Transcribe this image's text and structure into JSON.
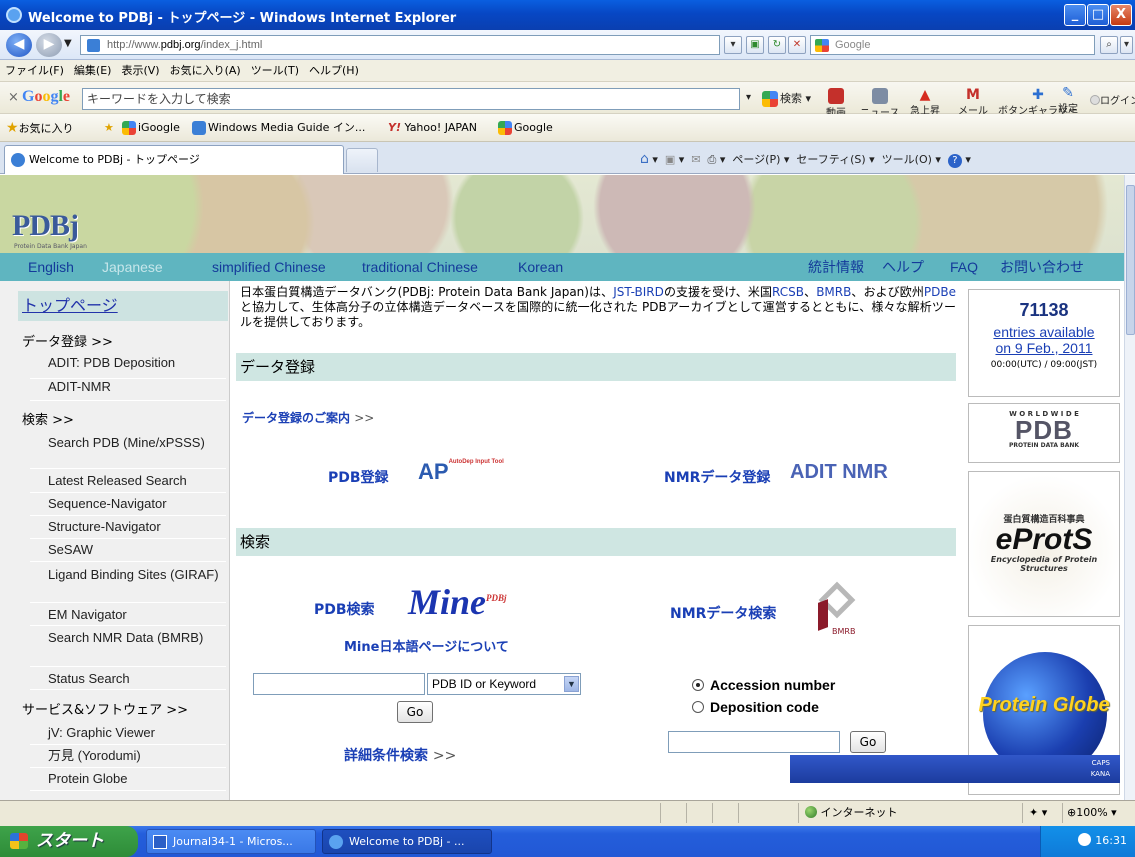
{
  "window": {
    "title": "Welcome to PDBj - トップページ - Windows Internet Explorer",
    "min": "_",
    "max": "□",
    "close": "X"
  },
  "address": {
    "url_prefix": "http://www.",
    "url_domain": "pdbj.org",
    "url_suffix": "/index_j.html",
    "search_placeholder": "Google"
  },
  "menu": [
    "ファイル(F)",
    "編集(E)",
    "表示(V)",
    "お気に入り(A)",
    "ツール(T)",
    "ヘルプ(H)"
  ],
  "google_toolbar": {
    "close": "×",
    "logo": "Google",
    "placeholder": "キーワードを入力して検索",
    "search": "検索",
    "items": [
      "動画",
      "ニュース",
      "急上昇",
      "メール",
      "ボタンギャラリー",
      "翻訳"
    ],
    "more": "»",
    "settings": "設定",
    "login": "ログイン"
  },
  "favorites": {
    "label": "お気に入り",
    "items": [
      "iGoogle",
      "Windows Media Guide イン...",
      "Yahoo! JAPAN",
      "Google"
    ]
  },
  "tab": {
    "title": "Welcome to PDBj - トップページ",
    "tools": [
      "ページ(P)",
      "セーフティ(S)",
      "ツール(O)"
    ]
  },
  "page": {
    "logo": "PDBj",
    "logo_sub": "Protein Data Bank Japan",
    "langs": [
      "English",
      "Japanese",
      "simplified Chinese",
      "traditional Chinese",
      "Korean"
    ],
    "top_links": [
      "統計情報",
      "ヘルプ",
      "FAQ",
      "お問い合わせ"
    ],
    "sidebar": {
      "top": "トップページ",
      "sections": [
        {
          "title": "データ登録 >>",
          "items": [
            "ADIT: PDB Deposition",
            "ADIT-NMR"
          ]
        },
        {
          "title": "検索 >>",
          "items": [
            "Search PDB (Mine/xPSSS)",
            "Latest Released Search",
            "Sequence-Navigator",
            "Structure-Navigator",
            "SeSAW",
            "Ligand Binding Sites (GIRAF)",
            "EM Navigator",
            "Search NMR Data (BMRB)",
            "Status Search"
          ]
        },
        {
          "title": "サービス&ソフトウェア >>",
          "items": [
            "jV: Graphic Viewer",
            "万見 (Yorodumi)",
            "Protein Globe"
          ]
        }
      ]
    },
    "intro": {
      "t1": "日本蛋白質構造データバンク(PDBj: Protein Data Bank Japan)は、",
      "l1": "JST-BIRD",
      "t2": "の支援を受け、米国",
      "l2": "RCSB",
      "t3": "、",
      "l3": "BMRB",
      "t4": "、および欧州",
      "l4": "PDBe",
      "t5": "と協力して、生体高分子の立体構造データベースを国際的に統一化された PDBアーカイブとして運営するとともに、様々な解析ツールを提供しております。"
    },
    "deposit": {
      "header": "データ登録",
      "guide": "データ登録のご案内",
      "guide_arrow": ">>",
      "pdb": "PDB登録",
      "pdb_icon": "AutoDep Input Tool",
      "nmr": "NMRデータ登録",
      "nmr_icon": "ADIT NMR"
    },
    "search": {
      "header": "検索",
      "pdb": "PDB検索",
      "mine": "Mine",
      "mine_sup": "PDBj",
      "mine_about": "Mine日本語ページについて",
      "select": "PDB ID or Keyword",
      "go": "Go",
      "detail": "詳細条件検索",
      "detail_arrow": ">>",
      "nmr": "NMRデータ検索",
      "bmrb": "BMRB",
      "radio1": "Accession number",
      "radio2": "Deposition code",
      "go2": "Go"
    },
    "right": {
      "count": "71138",
      "entries": "entries available",
      "date": "on 9 Feb., 2011",
      "time": "00:00(UTC) / 09:00(JST)",
      "wwpdb_top": "W O R L D W I D E",
      "wwpdb": "PDB",
      "wwpdb_sub": "PROTEIN DATA BANK",
      "eprots_top": "蛋白質構造百科事典",
      "eprots": "eProtS",
      "eprots_sub": "Encyclopedia of Protein Structures",
      "globe": "Protein Globe"
    }
  },
  "ime": {
    "caps": "CAPS",
    "kana": "KANA"
  },
  "status": {
    "zone": "インターネット",
    "zoom": "100%"
  },
  "taskbar": {
    "start": "スタート",
    "tasks": [
      "Journal34-1 - Micros...",
      "Welcome to PDBj - ..."
    ],
    "clock": "16:31"
  },
  "colors": {
    "langbar": "#5fb5c0",
    "section": "#cfe6e2",
    "link": "#1a3fb5"
  }
}
